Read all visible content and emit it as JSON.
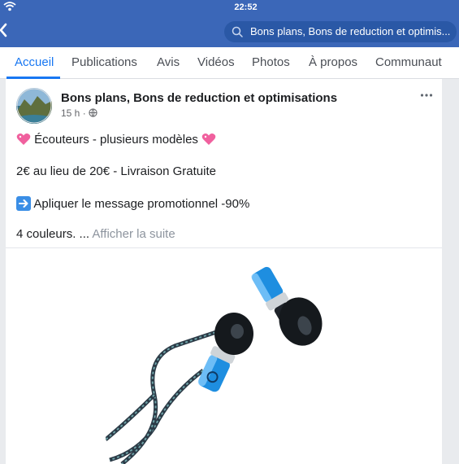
{
  "status_bar": {
    "time": "22:52"
  },
  "header": {
    "search_text": "Bons plans, Bons de reduction et optimis..."
  },
  "tabs": [
    {
      "label": "Accueil",
      "active": true
    },
    {
      "label": "Publications"
    },
    {
      "label": "Avis"
    },
    {
      "label": "Vidéos"
    },
    {
      "label": "Photos"
    },
    {
      "label": "À propos"
    },
    {
      "label": "Communaut"
    }
  ],
  "post": {
    "page_name": "Bons plans, Bons de reduction et optimisations",
    "time": "15 h",
    "privacy_icon": "globe-icon",
    "title": "Écouteurs - plusieurs modèles",
    "price_line": "2€ au lieu de 20€ - Livraison Gratuite",
    "promo_line": "Apliquer le message promotionnel -90%",
    "colors_line": "4 couleurs. ...",
    "see_more": "Afficher la suite"
  },
  "colors": {
    "header_bg": "#3b67b8",
    "accent": "#1877f2",
    "earbud_blue": "#1e8ee0"
  }
}
